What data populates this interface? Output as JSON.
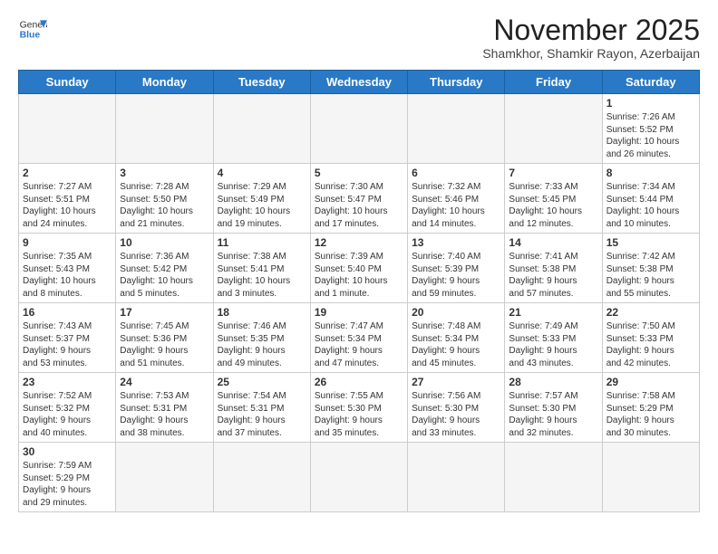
{
  "logo": {
    "line1": "General",
    "line2": "Blue"
  },
  "title": "November 2025",
  "subtitle": "Shamkhor, Shamkir Rayon, Azerbaijan",
  "weekdays": [
    "Sunday",
    "Monday",
    "Tuesday",
    "Wednesday",
    "Thursday",
    "Friday",
    "Saturday"
  ],
  "weeks": [
    [
      {
        "day": "",
        "info": ""
      },
      {
        "day": "",
        "info": ""
      },
      {
        "day": "",
        "info": ""
      },
      {
        "day": "",
        "info": ""
      },
      {
        "day": "",
        "info": ""
      },
      {
        "day": "",
        "info": ""
      },
      {
        "day": "1",
        "info": "Sunrise: 7:26 AM\nSunset: 5:52 PM\nDaylight: 10 hours\nand 26 minutes."
      }
    ],
    [
      {
        "day": "2",
        "info": "Sunrise: 7:27 AM\nSunset: 5:51 PM\nDaylight: 10 hours\nand 24 minutes."
      },
      {
        "day": "3",
        "info": "Sunrise: 7:28 AM\nSunset: 5:50 PM\nDaylight: 10 hours\nand 21 minutes."
      },
      {
        "day": "4",
        "info": "Sunrise: 7:29 AM\nSunset: 5:49 PM\nDaylight: 10 hours\nand 19 minutes."
      },
      {
        "day": "5",
        "info": "Sunrise: 7:30 AM\nSunset: 5:47 PM\nDaylight: 10 hours\nand 17 minutes."
      },
      {
        "day": "6",
        "info": "Sunrise: 7:32 AM\nSunset: 5:46 PM\nDaylight: 10 hours\nand 14 minutes."
      },
      {
        "day": "7",
        "info": "Sunrise: 7:33 AM\nSunset: 5:45 PM\nDaylight: 10 hours\nand 12 minutes."
      },
      {
        "day": "8",
        "info": "Sunrise: 7:34 AM\nSunset: 5:44 PM\nDaylight: 10 hours\nand 10 minutes."
      }
    ],
    [
      {
        "day": "9",
        "info": "Sunrise: 7:35 AM\nSunset: 5:43 PM\nDaylight: 10 hours\nand 8 minutes."
      },
      {
        "day": "10",
        "info": "Sunrise: 7:36 AM\nSunset: 5:42 PM\nDaylight: 10 hours\nand 5 minutes."
      },
      {
        "day": "11",
        "info": "Sunrise: 7:38 AM\nSunset: 5:41 PM\nDaylight: 10 hours\nand 3 minutes."
      },
      {
        "day": "12",
        "info": "Sunrise: 7:39 AM\nSunset: 5:40 PM\nDaylight: 10 hours\nand 1 minute."
      },
      {
        "day": "13",
        "info": "Sunrise: 7:40 AM\nSunset: 5:39 PM\nDaylight: 9 hours\nand 59 minutes."
      },
      {
        "day": "14",
        "info": "Sunrise: 7:41 AM\nSunset: 5:38 PM\nDaylight: 9 hours\nand 57 minutes."
      },
      {
        "day": "15",
        "info": "Sunrise: 7:42 AM\nSunset: 5:38 PM\nDaylight: 9 hours\nand 55 minutes."
      }
    ],
    [
      {
        "day": "16",
        "info": "Sunrise: 7:43 AM\nSunset: 5:37 PM\nDaylight: 9 hours\nand 53 minutes."
      },
      {
        "day": "17",
        "info": "Sunrise: 7:45 AM\nSunset: 5:36 PM\nDaylight: 9 hours\nand 51 minutes."
      },
      {
        "day": "18",
        "info": "Sunrise: 7:46 AM\nSunset: 5:35 PM\nDaylight: 9 hours\nand 49 minutes."
      },
      {
        "day": "19",
        "info": "Sunrise: 7:47 AM\nSunset: 5:34 PM\nDaylight: 9 hours\nand 47 minutes."
      },
      {
        "day": "20",
        "info": "Sunrise: 7:48 AM\nSunset: 5:34 PM\nDaylight: 9 hours\nand 45 minutes."
      },
      {
        "day": "21",
        "info": "Sunrise: 7:49 AM\nSunset: 5:33 PM\nDaylight: 9 hours\nand 43 minutes."
      },
      {
        "day": "22",
        "info": "Sunrise: 7:50 AM\nSunset: 5:33 PM\nDaylight: 9 hours\nand 42 minutes."
      }
    ],
    [
      {
        "day": "23",
        "info": "Sunrise: 7:52 AM\nSunset: 5:32 PM\nDaylight: 9 hours\nand 40 minutes."
      },
      {
        "day": "24",
        "info": "Sunrise: 7:53 AM\nSunset: 5:31 PM\nDaylight: 9 hours\nand 38 minutes."
      },
      {
        "day": "25",
        "info": "Sunrise: 7:54 AM\nSunset: 5:31 PM\nDaylight: 9 hours\nand 37 minutes."
      },
      {
        "day": "26",
        "info": "Sunrise: 7:55 AM\nSunset: 5:30 PM\nDaylight: 9 hours\nand 35 minutes."
      },
      {
        "day": "27",
        "info": "Sunrise: 7:56 AM\nSunset: 5:30 PM\nDaylight: 9 hours\nand 33 minutes."
      },
      {
        "day": "28",
        "info": "Sunrise: 7:57 AM\nSunset: 5:30 PM\nDaylight: 9 hours\nand 32 minutes."
      },
      {
        "day": "29",
        "info": "Sunrise: 7:58 AM\nSunset: 5:29 PM\nDaylight: 9 hours\nand 30 minutes."
      }
    ],
    [
      {
        "day": "30",
        "info": "Sunrise: 7:59 AM\nSunset: 5:29 PM\nDaylight: 9 hours\nand 29 minutes."
      },
      {
        "day": "",
        "info": ""
      },
      {
        "day": "",
        "info": ""
      },
      {
        "day": "",
        "info": ""
      },
      {
        "day": "",
        "info": ""
      },
      {
        "day": "",
        "info": ""
      },
      {
        "day": "",
        "info": ""
      }
    ]
  ]
}
